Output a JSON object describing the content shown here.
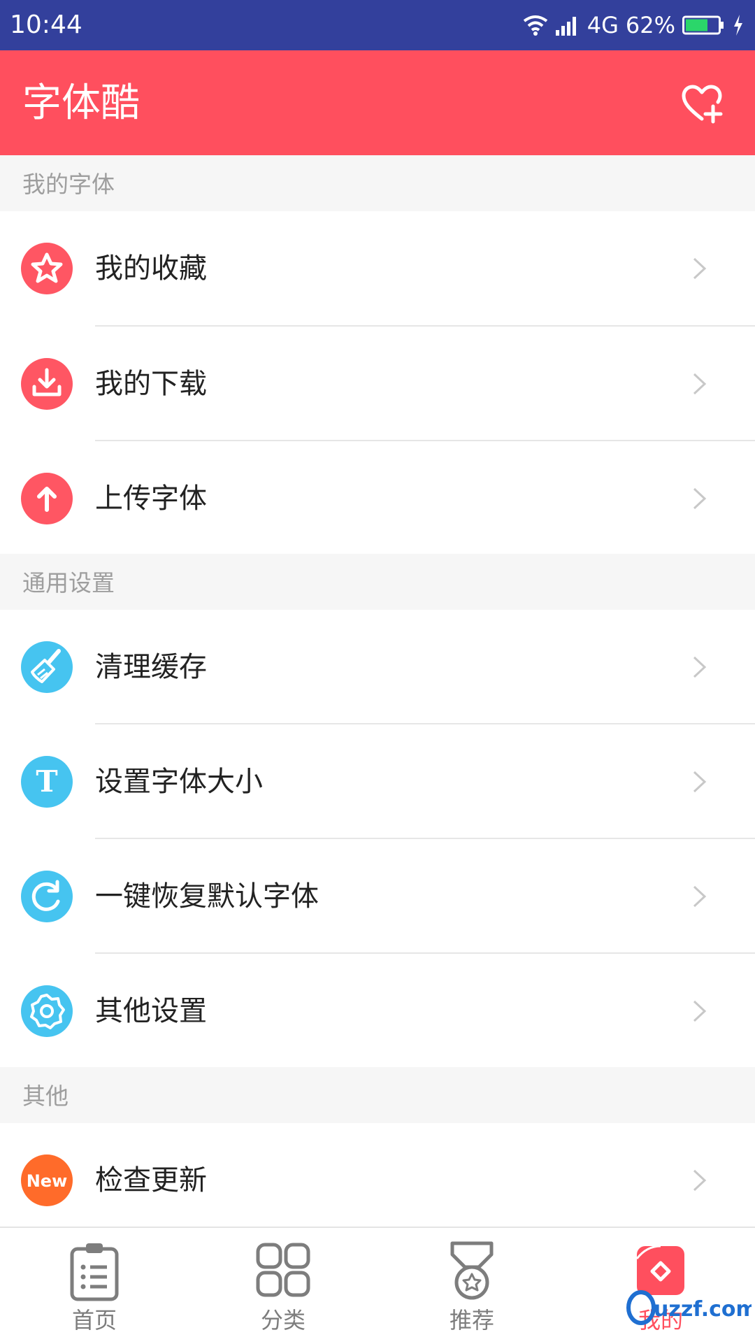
{
  "status_bar": {
    "time": "10:44",
    "network": "4G",
    "battery": "62%"
  },
  "app_bar": {
    "title": "字体酷",
    "action_icon": "heart-plus-icon"
  },
  "colors": {
    "accent": "#ff4f5e",
    "status": "#33409c",
    "blue": "#46c4f0",
    "orange": "#ff6b2a"
  },
  "sections": [
    {
      "title": "我的字体",
      "items": [
        {
          "label": "我的收藏",
          "icon": "star-icon"
        },
        {
          "label": "我的下载",
          "icon": "download-icon"
        },
        {
          "label": "上传字体",
          "icon": "upload-icon"
        }
      ]
    },
    {
      "title": "通用设置",
      "items": [
        {
          "label": "清理缓存",
          "icon": "broom-icon"
        },
        {
          "label": "设置字体大小",
          "icon": "font-t-icon"
        },
        {
          "label": "一键恢复默认字体",
          "icon": "refresh-icon"
        },
        {
          "label": "其他设置",
          "icon": "gear-icon"
        }
      ]
    },
    {
      "title": "其他",
      "items": [
        {
          "label": "检查更新",
          "icon": "new-badge-icon",
          "badge": "New"
        }
      ]
    }
  ],
  "tabs": [
    {
      "label": "首页",
      "icon": "clipboard-icon",
      "active": false
    },
    {
      "label": "分类",
      "icon": "grid-icon",
      "active": false
    },
    {
      "label": "推荐",
      "icon": "medal-icon",
      "active": false
    },
    {
      "label": "我的",
      "icon": "profile-icon",
      "active": true
    }
  ],
  "watermark": "uzzf.com"
}
